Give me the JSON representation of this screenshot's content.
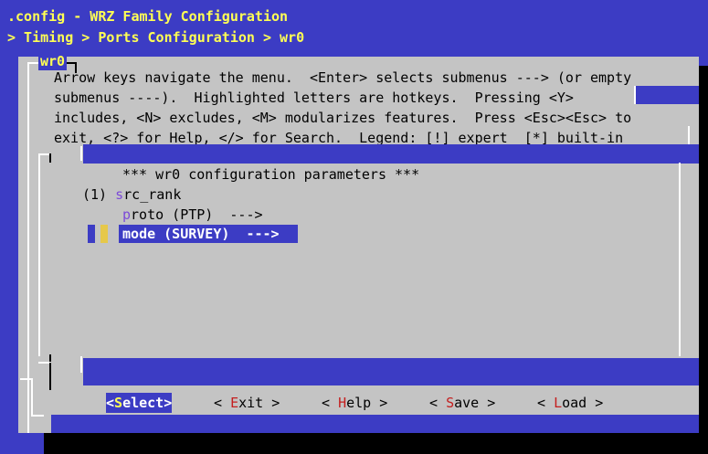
{
  "header": {
    "title_line": ".config - WRZ Family Configuration",
    "breadcrumb": "> Timing > Ports Configuration > wr0"
  },
  "dialog": {
    "title": "wr0",
    "help_lines": [
      "Arrow keys navigate the menu.  <Enter> selects submenus ---> (or empty",
      "submenus ----).  Highlighted letters are hotkeys.  Pressing <Y>",
      "includes, <N> excludes, <M> modularizes features.  Press <Esc><Esc> to",
      "exit, <?> for Help, </> for Search.  Legend: [!] expert  [*] built-in"
    ]
  },
  "menu": {
    "heading": "*** wr0 configuration parameters ***",
    "items": [
      {
        "prefix": "(1) ",
        "hotkey": "s",
        "rest": "rc_rank",
        "selected": false
      },
      {
        "prefix": "",
        "hotkey": "p",
        "rest": "roto (PTP)  --->",
        "selected": false
      },
      {
        "prefix": "",
        "hotkey": "mo",
        "rest": "de (SURVEY)  --->",
        "selected": true
      }
    ]
  },
  "buttons": [
    {
      "open": "<",
      "hotkey": "S",
      "rest": "elect",
      "close": ">",
      "selected": true
    },
    {
      "open": "< ",
      "hotkey": "E",
      "rest": "xit",
      "close": " >",
      "selected": false
    },
    {
      "open": "< ",
      "hotkey": "H",
      "rest": "elp",
      "close": " >",
      "selected": false
    },
    {
      "open": "< ",
      "hotkey": "S",
      "rest": "ave",
      "close": " >",
      "selected": false
    },
    {
      "open": "< ",
      "hotkey": "L",
      "rest": "oad",
      "close": " >",
      "selected": false
    }
  ],
  "colors": {
    "background": "#3c3cc4",
    "panel": "#c4c4c4",
    "header_text": "#ffff54",
    "hotkey": "#7c4ad8",
    "button_hotkey": "#c41e1e"
  }
}
